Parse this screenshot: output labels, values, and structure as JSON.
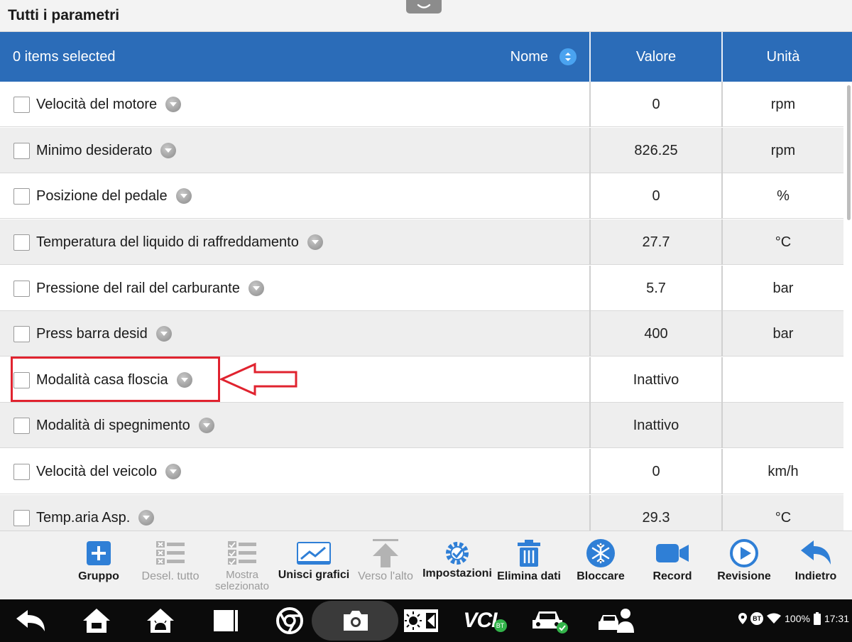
{
  "title": "Tutti i parametri",
  "header": {
    "selected": "0 items selected",
    "name": "Nome",
    "value": "Valore",
    "unit": "Unità"
  },
  "rows": [
    {
      "name": "Velocità del motore",
      "value": "0",
      "unit": "rpm"
    },
    {
      "name": "Minimo desiderato",
      "value": "826.25",
      "unit": "rpm"
    },
    {
      "name": "Posizione del pedale",
      "value": "0",
      "unit": "%"
    },
    {
      "name": "Temperatura del liquido di raffreddamento",
      "value": "27.7",
      "unit": "°C"
    },
    {
      "name": "Pressione del rail del carburante",
      "value": "5.7",
      "unit": "bar"
    },
    {
      "name": "Press barra desid",
      "value": "400",
      "unit": "bar"
    },
    {
      "name": "Modalità casa floscia",
      "value": "Inattivo",
      "unit": ""
    },
    {
      "name": "Modalità di spegnimento",
      "value": "Inattivo",
      "unit": ""
    },
    {
      "name": "Velocità del veicolo",
      "value": "0",
      "unit": "km/h"
    },
    {
      "name": "Temp.aria Asp.",
      "value": "29.3",
      "unit": "°C"
    }
  ],
  "toolbar": {
    "group": "Gruppo",
    "deselect_all": "Desel. tutto",
    "show_selected": "Mostra selezionato",
    "merge_graphs": "Unisci grafici",
    "to_top": "Verso l'alto",
    "settings": "Impostazioni",
    "clear_data": "Elimina dati",
    "freeze": "Bloccare",
    "record": "Record",
    "review": "Revisione",
    "back": "Indietro"
  },
  "status": {
    "bt": "BT",
    "battery": "100%",
    "time": "17:31"
  },
  "nav": {
    "vci_label": "VCI",
    "vci_badge": "BT"
  },
  "colors": {
    "header_blue": "#2b6cb8",
    "toolbar_icon_blue": "#2f7fd6",
    "annotation_red": "#e0232f"
  }
}
